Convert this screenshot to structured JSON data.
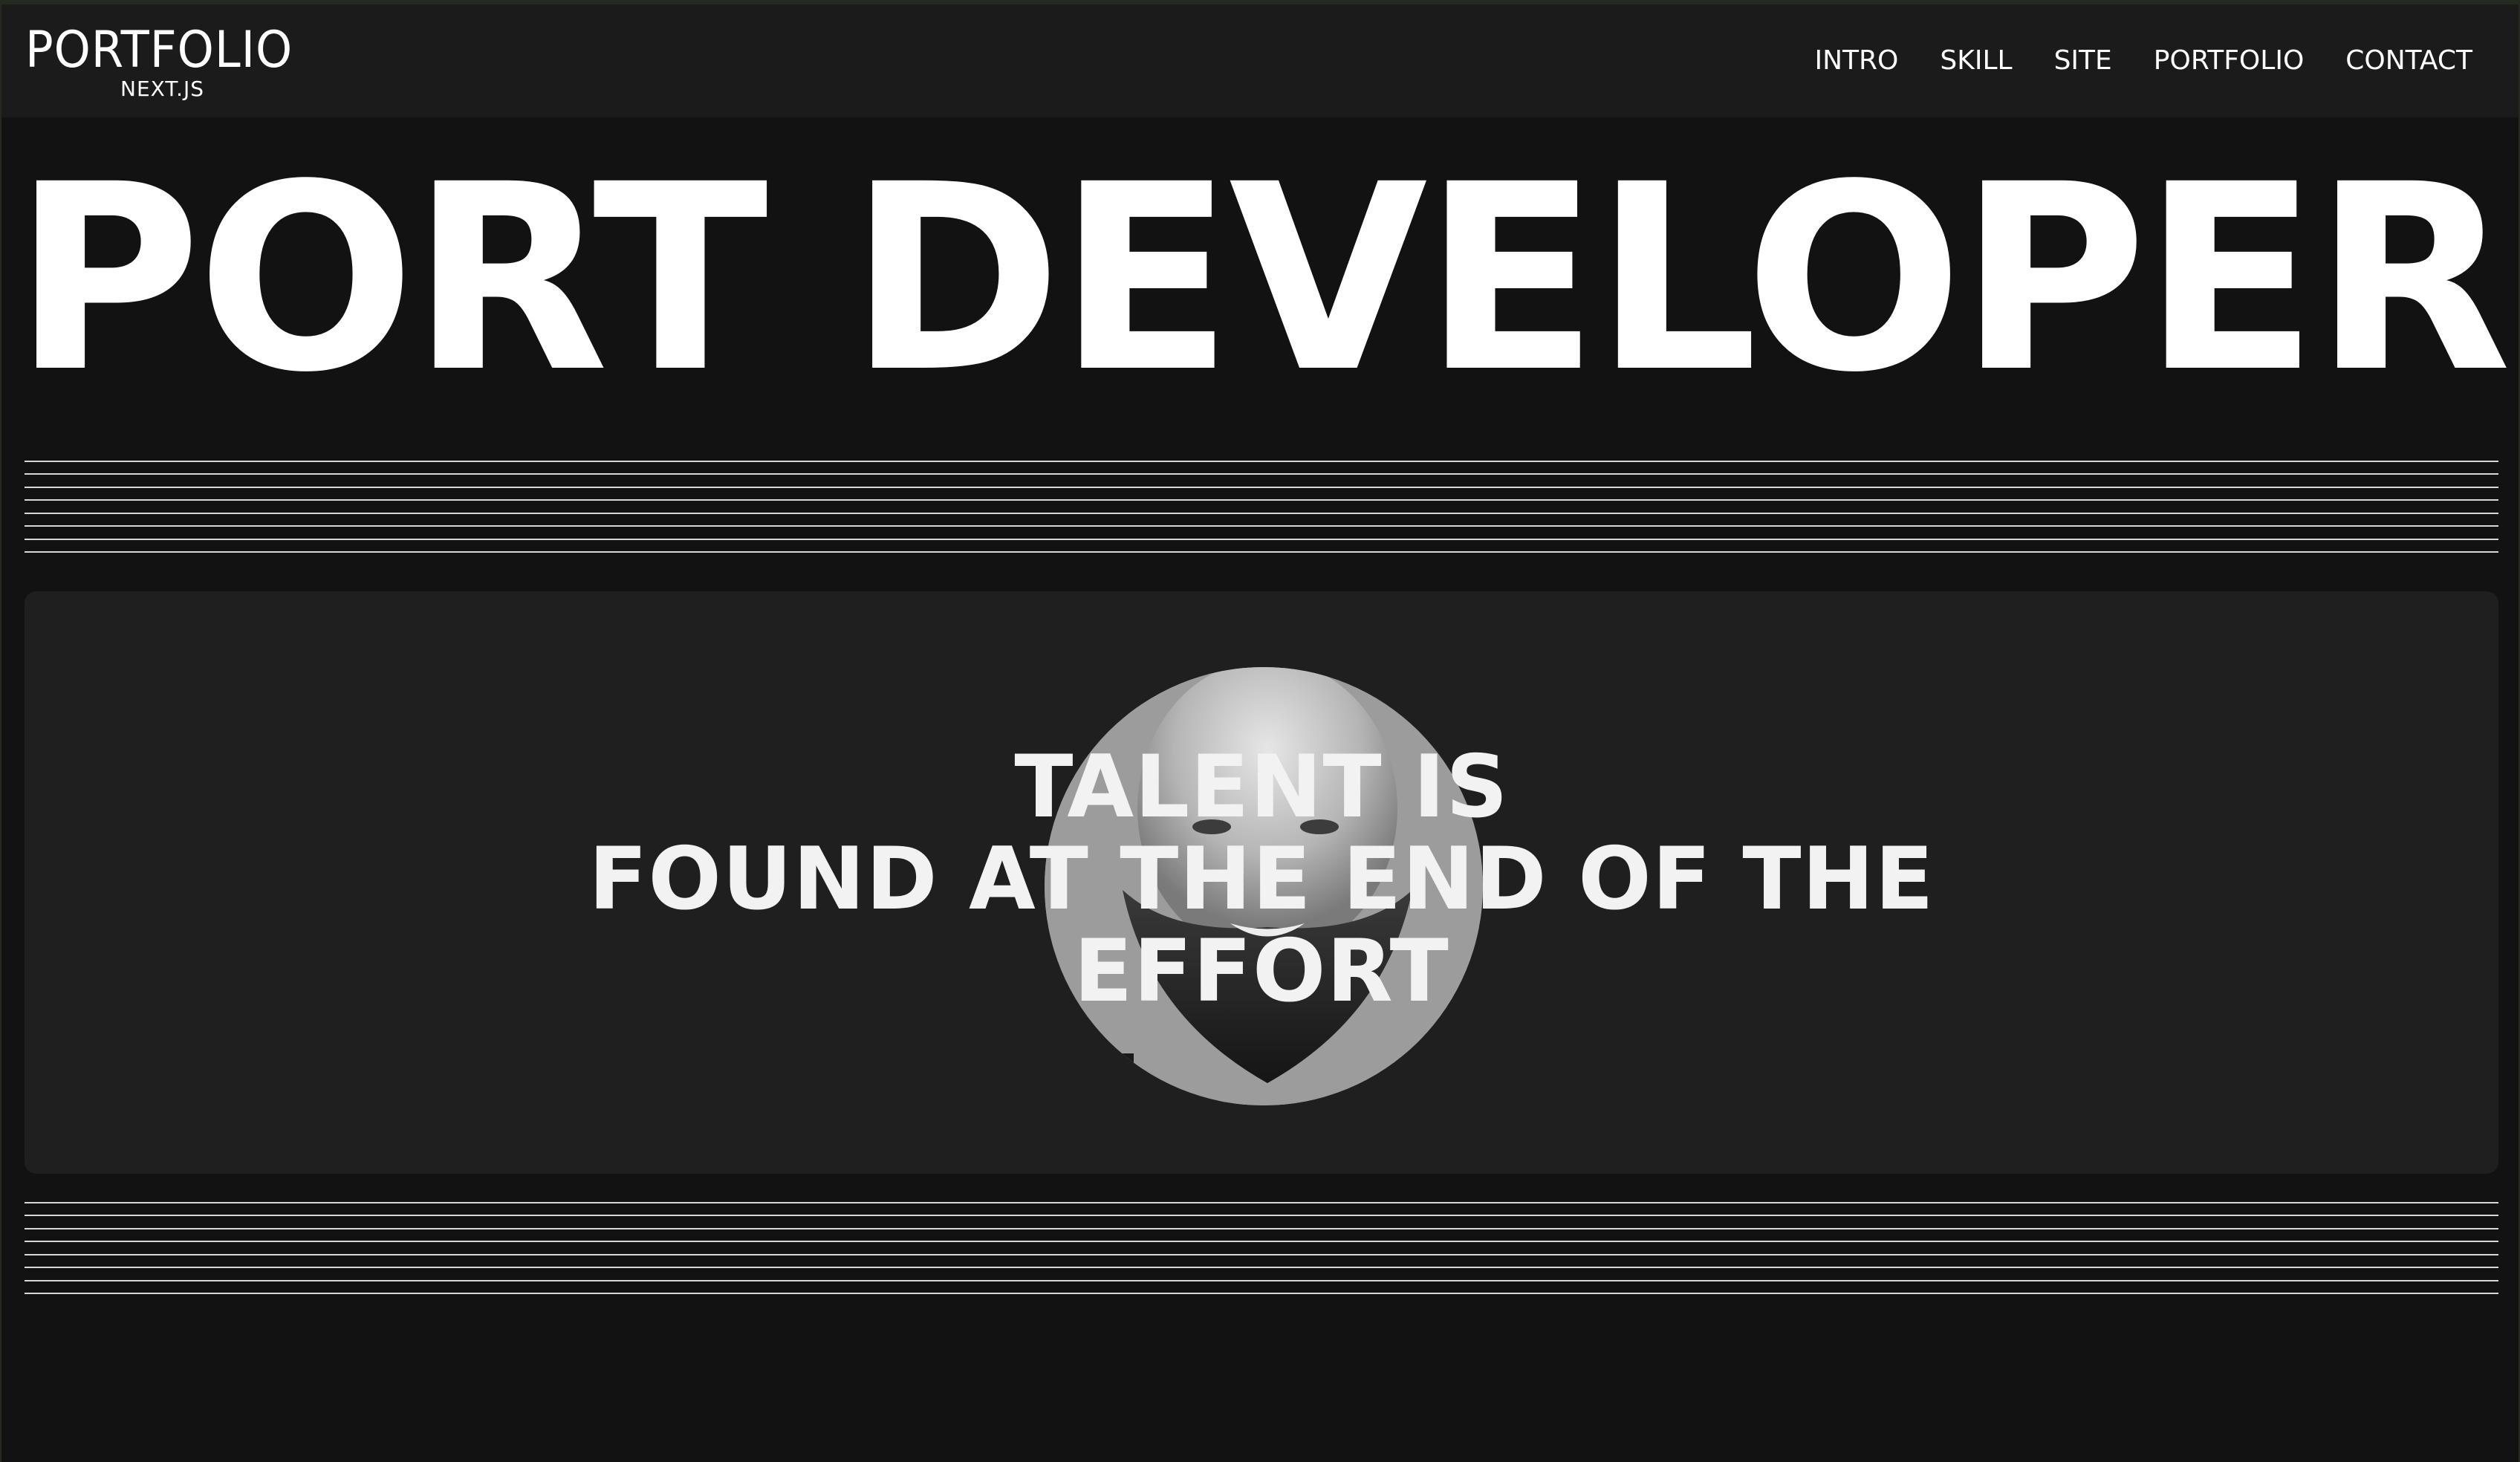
{
  "header": {
    "logo_title": "PORTFOLIO",
    "logo_subtitle": "NEXT.JS",
    "nav": [
      "INTRO",
      "SKILL",
      "SITE",
      "PORTFOLIO",
      "CONTACT"
    ]
  },
  "hero": {
    "title": "PORT DEVELOPER"
  },
  "quote": {
    "lines": [
      "TALENT IS",
      "FOUND AT THE END OF THE",
      "EFFORT"
    ]
  },
  "colors": {
    "page_background": "#121212",
    "header_background": "#1b1b1b",
    "card_background": "#1f1f1f",
    "text": "#ffffff"
  }
}
